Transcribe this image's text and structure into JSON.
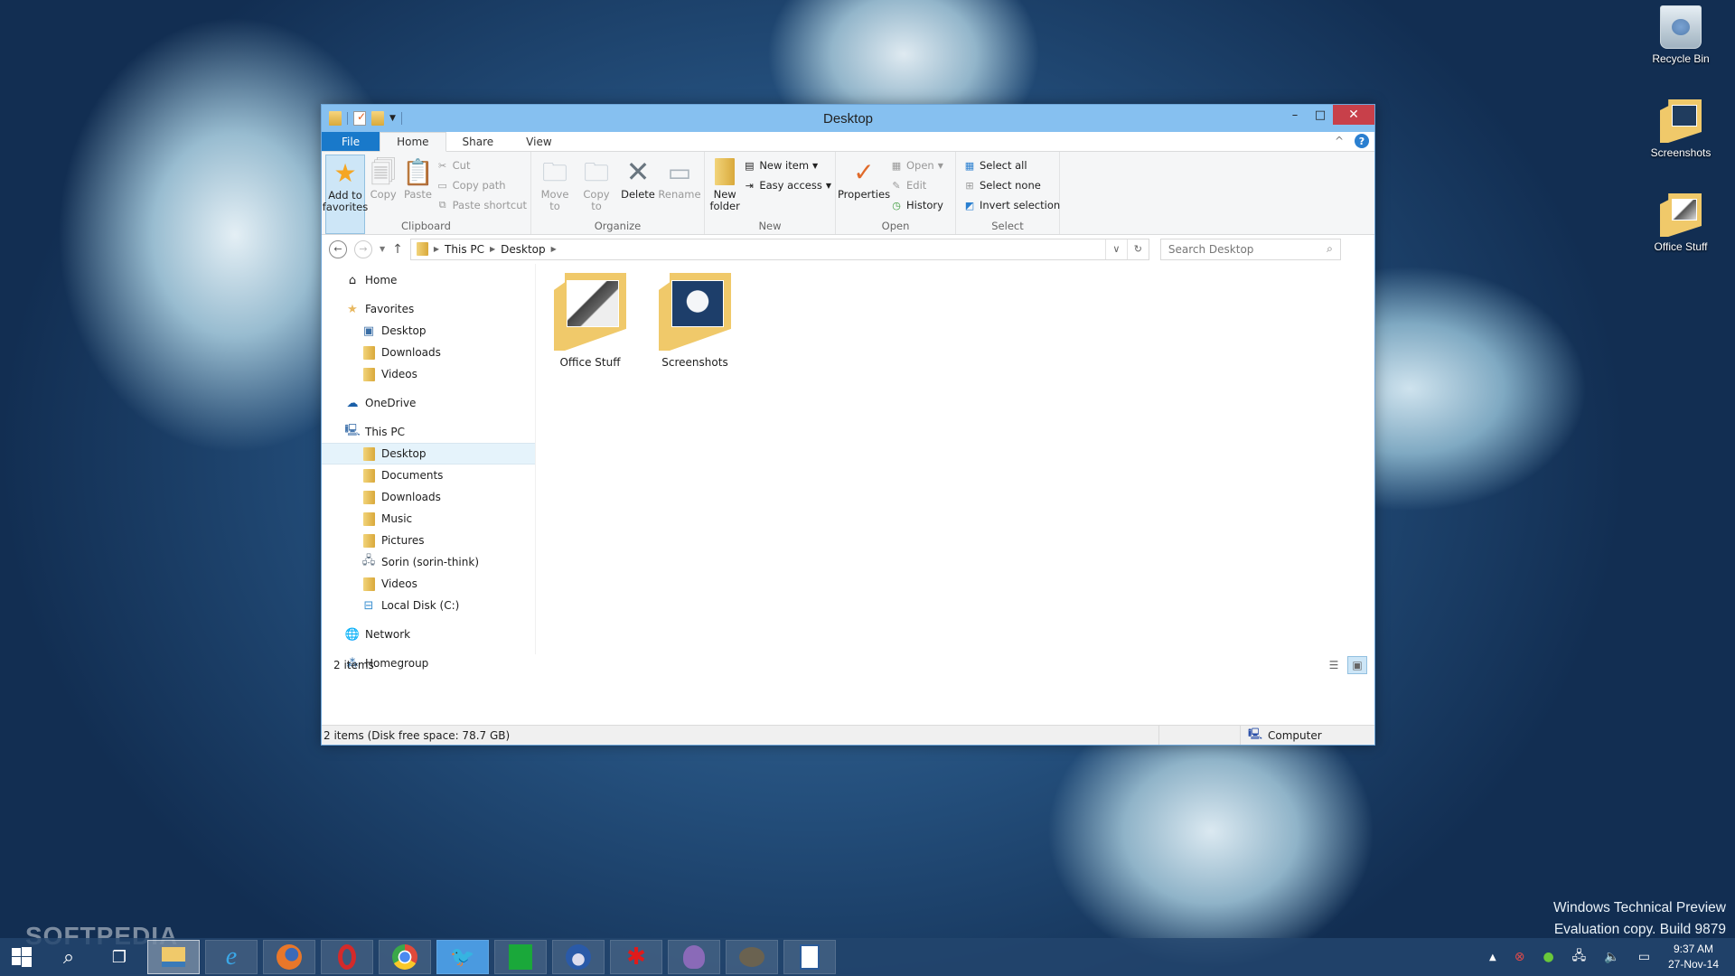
{
  "desktop": {
    "icons": [
      {
        "label": "Recycle Bin",
        "icon": "recycle-bin-icon"
      },
      {
        "label": "Screenshots",
        "icon": "folder-icon"
      },
      {
        "label": "Office Stuff",
        "icon": "folder-icon"
      }
    ],
    "watermark_line1": "Windows Technical Preview",
    "watermark_line2": "Evaluation copy. Build 9879",
    "softpedia": "SOFTPEDIA"
  },
  "window": {
    "title": "Desktop",
    "controls": {
      "minimize": "–",
      "maximize": "□",
      "close": "✕"
    },
    "tabs": [
      {
        "label": "File"
      },
      {
        "label": "Home",
        "active": true
      },
      {
        "label": "Share"
      },
      {
        "label": "View"
      }
    ],
    "ribbon": {
      "clipboard": {
        "label": "Clipboard",
        "add_to_favorites": "Add to favorites",
        "copy": "Copy",
        "paste": "Paste",
        "cut": "Cut",
        "copy_path": "Copy path",
        "paste_shortcut": "Paste shortcut"
      },
      "organize": {
        "label": "Organize",
        "move_to": "Move to",
        "copy_to": "Copy to",
        "delete": "Delete",
        "rename": "Rename"
      },
      "new": {
        "label": "New",
        "new_folder": "New folder",
        "new_item": "New item",
        "easy_access": "Easy access"
      },
      "open": {
        "label": "Open",
        "properties": "Properties",
        "open": "Open",
        "edit": "Edit",
        "history": "History"
      },
      "select": {
        "label": "Select",
        "select_all": "Select all",
        "select_none": "Select none",
        "invert_selection": "Invert selection"
      }
    },
    "address": {
      "breadcrumb": [
        "This PC",
        "Desktop"
      ],
      "search_placeholder": "Search Desktop"
    },
    "nav": {
      "home": "Home",
      "favorites": "Favorites",
      "favorites_items": [
        "Desktop",
        "Downloads",
        "Videos"
      ],
      "onedrive": "OneDrive",
      "this_pc": "This PC",
      "this_pc_items": [
        "Desktop",
        "Documents",
        "Downloads",
        "Music",
        "Pictures",
        "Sorin (sorin-think)",
        "Videos",
        "Local Disk (C:)"
      ],
      "network": "Network",
      "homegroup": "Homegroup",
      "selected": "Desktop"
    },
    "files": [
      {
        "name": "Office Stuff",
        "type": "folder"
      },
      {
        "name": "Screenshots",
        "type": "folder"
      }
    ],
    "item_count": "2 items",
    "statusbar": {
      "left": "2 items (Disk free space: 78.7 GB)",
      "right": "Computer"
    }
  },
  "taskbar": {
    "apps": [
      "File Explorer",
      "Internet Explorer",
      "Firefox",
      "Opera",
      "Chrome",
      "Twitter",
      "Store",
      "Thunderbird",
      "Bug tracker",
      "Pidgin",
      "GIMP",
      "LibreOffice Writer"
    ],
    "active_app": "File Explorer",
    "clock_time": "9:37 AM",
    "clock_date": "27-Nov-14"
  },
  "colors": {
    "file_tab": "#1979ca",
    "titlebar": "#86c0f0",
    "close": "#c8404a",
    "selection": "#cde6f7"
  }
}
